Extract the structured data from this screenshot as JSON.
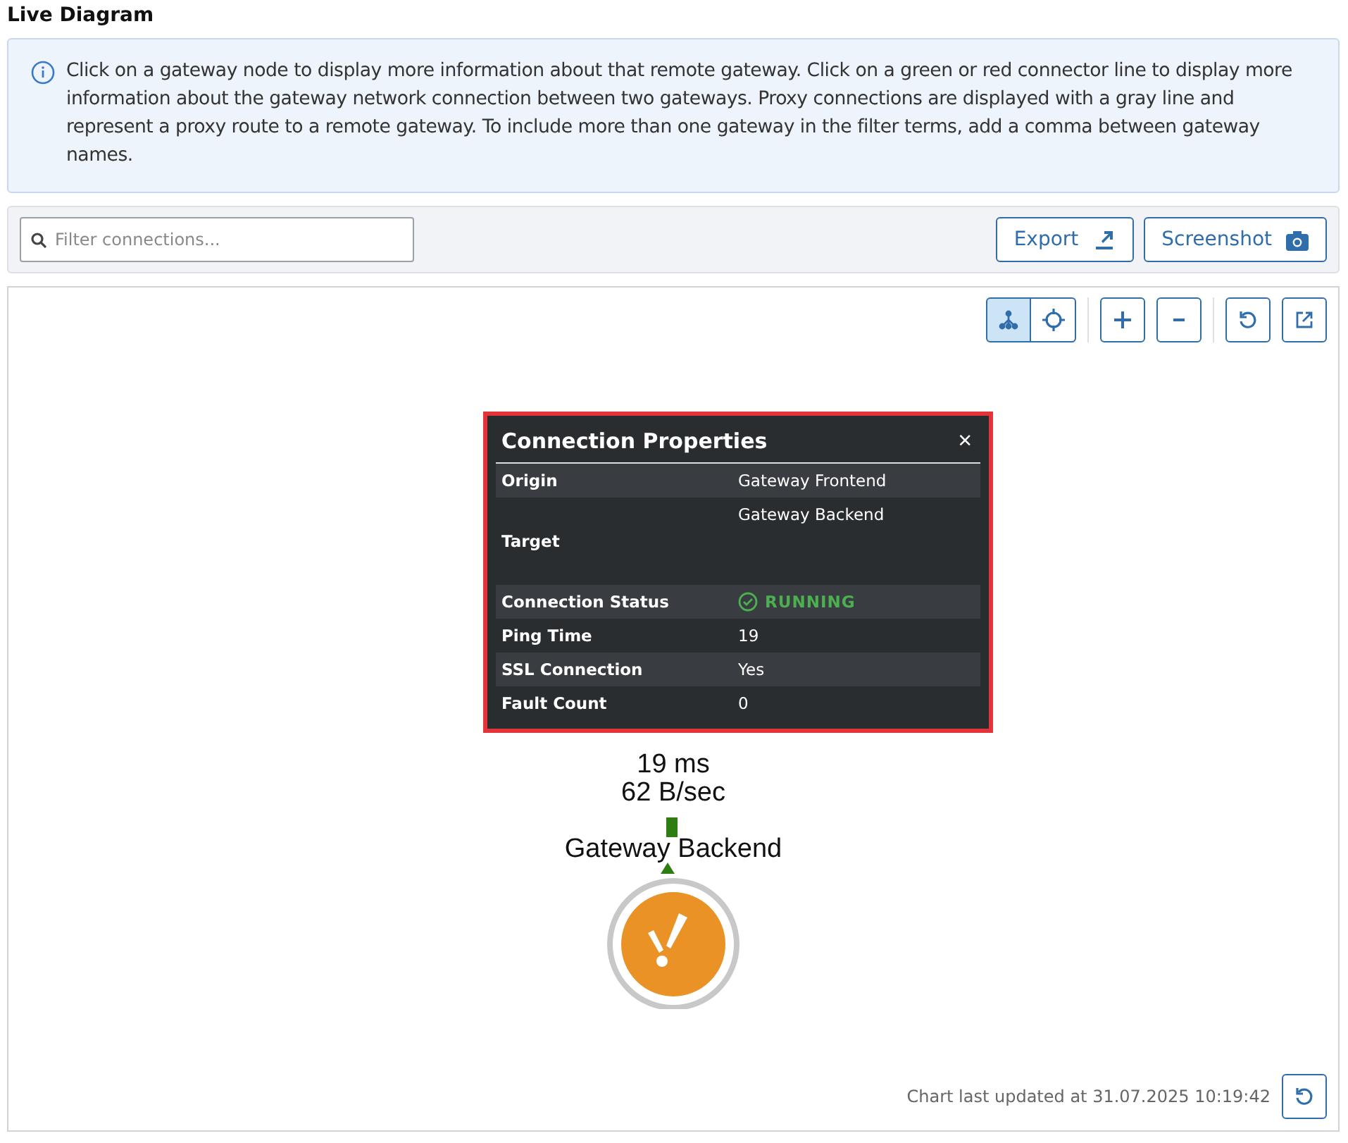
{
  "title": "Live Diagram",
  "info": "Click on a gateway node to display more information about that remote gateway. Click on a green or red connector line to display more information about the gateway network connection between two gateways. Proxy connections are displayed with a gray line and represent a proxy route to a remote gateway. To include more than one gateway in the filter terms, add a comma between gateway names.",
  "filter": {
    "placeholder": "Filter connections..."
  },
  "actions": [
    {
      "label": "Export",
      "kind": "export"
    },
    {
      "label": "Screenshot",
      "kind": "camera"
    }
  ],
  "view_buttons": [
    {
      "kind": "hierarchy",
      "selected": true
    },
    {
      "kind": "radial",
      "selected": false
    },
    {
      "kind": "zoom-in",
      "selected": false
    },
    {
      "kind": "zoom-out",
      "selected": false
    },
    {
      "kind": "reset",
      "selected": false
    },
    {
      "kind": "popout",
      "selected": false
    }
  ],
  "edge": {
    "ping": "19 ms",
    "rate": "62 B/sec",
    "kind": "running"
  },
  "node": {
    "label": "Gateway Backend",
    "kind": "warning"
  },
  "popup": {
    "title": "Connection Properties",
    "close": "×",
    "rows": [
      {
        "label": "Origin",
        "value": "Gateway Frontend",
        "kind": "text"
      },
      {
        "label": "Target",
        "value": "Gateway Backend",
        "kind": "tall"
      },
      {
        "label": "Connection Status",
        "value": "RUNNING",
        "kind": "status"
      },
      {
        "label": "Ping Time",
        "value": "19",
        "kind": "text"
      },
      {
        "label": "SSL Connection",
        "value": "Yes",
        "kind": "text"
      },
      {
        "label": "Fault Count",
        "value": "0",
        "kind": "text"
      }
    ]
  },
  "updated": "Chart last updated at 31.07.2025 10:19:42"
}
